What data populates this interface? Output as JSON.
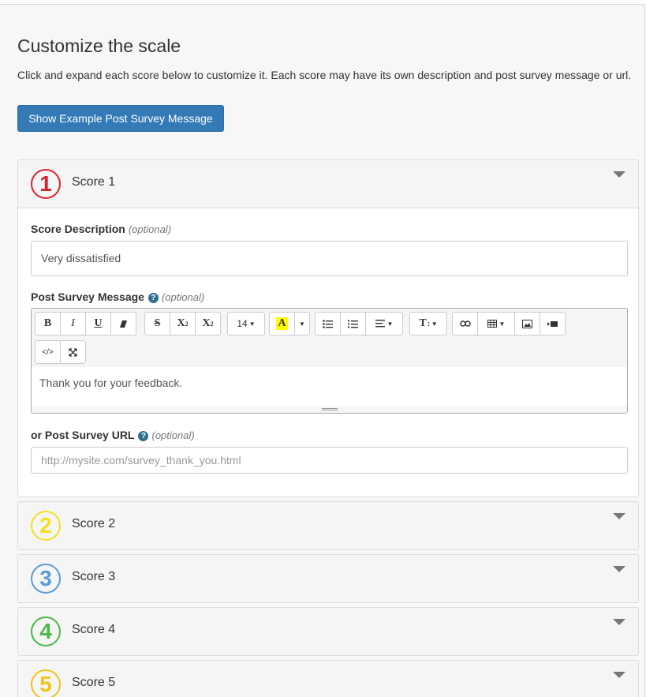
{
  "page": {
    "title": "Customize the scale",
    "intro": "Click and expand each score below to customize it. Each score may have its own description and post survey message or url.",
    "example_button": "Show Example Post Survey Message"
  },
  "scores": [
    {
      "number": "1",
      "label": "Score 1",
      "color": "#d9232d",
      "expanded": true
    },
    {
      "number": "2",
      "label": "Score 2",
      "color": "#f2e11f"
    },
    {
      "number": "3",
      "label": "Score 3",
      "color": "#5b9bd5"
    },
    {
      "number": "4",
      "label": "Score 4",
      "color": "#4cb848"
    },
    {
      "number": "5",
      "label": "Score 5",
      "color": "#f0c419"
    }
  ],
  "score1": {
    "description_label": "Score Description",
    "optional": "(optional)",
    "description_value": "Very dissatisfied",
    "message_label": "Post Survey Message",
    "message_text": "Thank you for your feedback.",
    "url_label": "or Post Survey URL",
    "url_placeholder": "http://mysite.com/survey_thank_you.html"
  },
  "toolbar": {
    "bold": "B",
    "italic": "I",
    "underline": "U",
    "eraser": "eraser-icon",
    "strike": "S",
    "superscript": "X",
    "subscript": "X",
    "font_size": "14",
    "font_color": "A",
    "color_accent": "#ffff00",
    "unordered_list": "unordered-list-icon",
    "ordered_list": "ordered-list-icon",
    "align": "align-icon",
    "text_height": "T",
    "link": "link-icon",
    "table": "table-icon",
    "picture": "picture-icon",
    "video": "video-icon",
    "code_view": "</>",
    "fullscreen": "fullscreen-icon"
  }
}
